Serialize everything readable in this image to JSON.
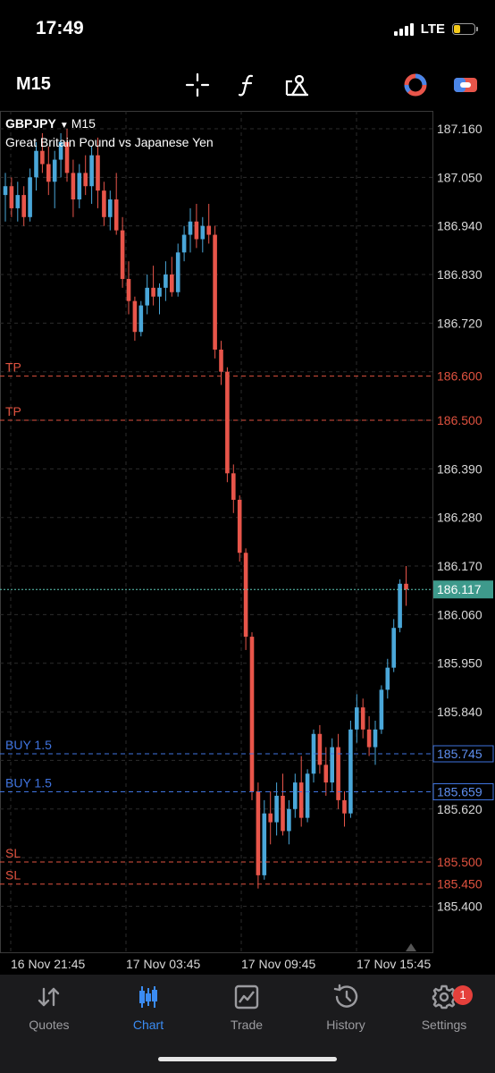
{
  "status_bar": {
    "time": "17:49",
    "network": "LTE",
    "battery_level": 0.3
  },
  "toolbar": {
    "timeframe": "M15",
    "icons": [
      "crosshair-icon",
      "function-icon",
      "objects-icon",
      "indicator-color-icon",
      "trade-toggle-icon"
    ]
  },
  "chart": {
    "symbol": "GBPJPY",
    "timeframe": "M15",
    "description": "Great Britain Pound vs Japanese Yen",
    "price_labels": [
      "187.160",
      "187.050",
      "186.940",
      "186.830",
      "186.720",
      "186.600",
      "186.500",
      "186.390",
      "186.280",
      "186.170",
      "186.117",
      "186.060",
      "185.950",
      "185.840",
      "185.745",
      "185.659",
      "185.620",
      "185.500",
      "185.450",
      "185.400"
    ],
    "current_price": "186.117",
    "order_lines": [
      {
        "label": "TP",
        "price": "186.600",
        "price_value": 186.6,
        "color": "#e0523f"
      },
      {
        "label": "TP",
        "price": "186.500",
        "price_value": 186.5,
        "color": "#e0523f"
      },
      {
        "label": "BUY 1.5",
        "price": "185.745",
        "price_value": 185.745,
        "color": "#3f74e0"
      },
      {
        "label": "BUY 1.5",
        "price": "185.659",
        "price_value": 185.659,
        "color": "#3f74e0"
      },
      {
        "label": "SL",
        "price": "185.500",
        "price_value": 185.5,
        "color": "#e0523f"
      },
      {
        "label": "SL",
        "price": "185.450",
        "price_value": 185.45,
        "color": "#e0523f"
      }
    ],
    "time_labels": [
      "16 Nov 21:45",
      "17 Nov 03:45",
      "17 Nov 09:45",
      "17 Nov 15:45"
    ],
    "colors": {
      "bull": "#4aa7d9",
      "bear": "#e8554a",
      "bid_line": "#5ec9b8"
    }
  },
  "tab_bar": {
    "tabs": [
      {
        "label": "Quotes",
        "icon": "quotes-icon"
      },
      {
        "label": "Chart",
        "icon": "chart-icon",
        "active": true
      },
      {
        "label": "Trade",
        "icon": "trade-icon"
      },
      {
        "label": "History",
        "icon": "history-icon"
      },
      {
        "label": "Settings",
        "icon": "settings-icon",
        "badge": "1"
      }
    ]
  }
}
